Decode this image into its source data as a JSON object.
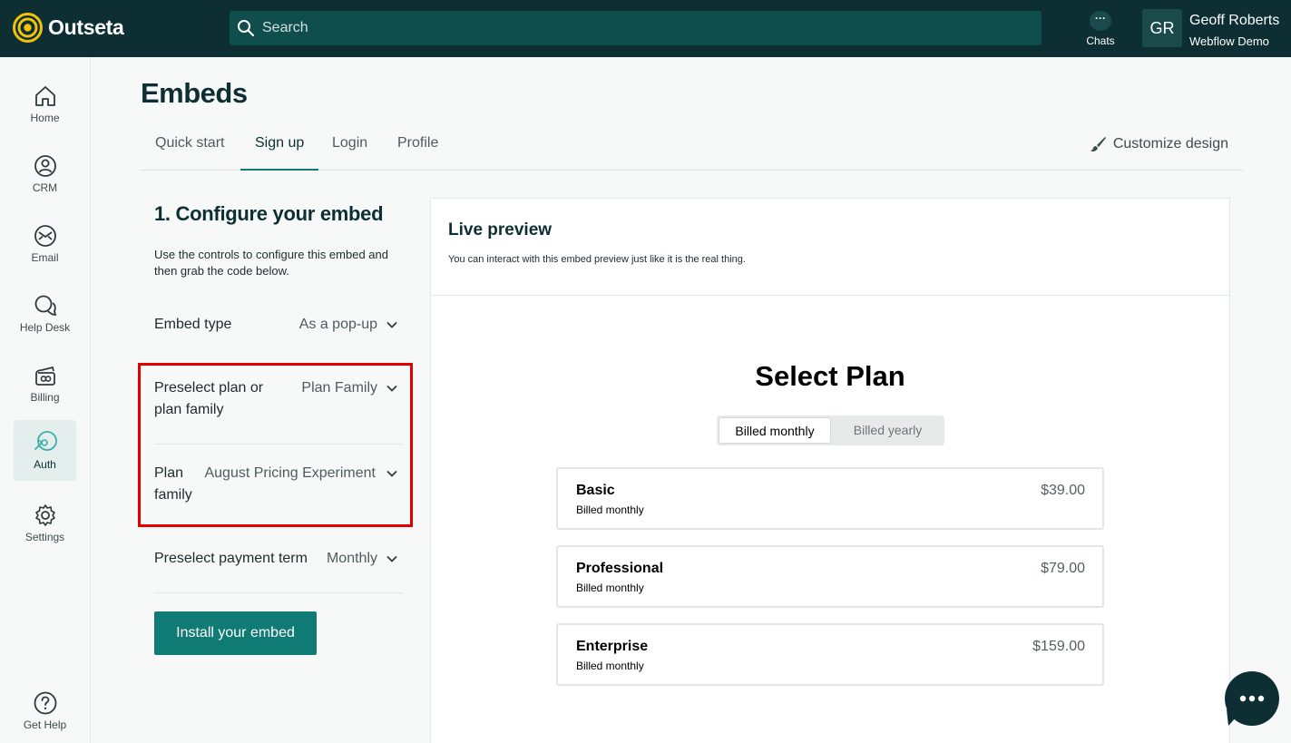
{
  "brand": {
    "name": "Outseta",
    "accent": "#f4c20d",
    "topbar_bg": "#0d2f33",
    "primary": "#0f7b74"
  },
  "search": {
    "placeholder": "Search"
  },
  "header": {
    "chats_label": "Chats",
    "chats_glyph": "···",
    "avatar_initials": "GR",
    "user_name": "Geoff Roberts",
    "user_org": "Webflow Demo"
  },
  "sidebar": {
    "items": [
      {
        "label": "Home",
        "icon": "home-icon"
      },
      {
        "label": "CRM",
        "icon": "crm-icon"
      },
      {
        "label": "Email",
        "icon": "email-icon"
      },
      {
        "label": "Help Desk",
        "icon": "help-desk-icon"
      },
      {
        "label": "Billing",
        "icon": "billing-icon"
      },
      {
        "label": "Auth",
        "icon": "auth-icon",
        "active": true
      },
      {
        "label": "Settings",
        "icon": "gear-icon"
      }
    ],
    "help_label": "Get Help"
  },
  "page": {
    "title": "Embeds",
    "tabs": [
      "Quick start",
      "Sign up",
      "Login",
      "Profile"
    ],
    "active_tab": "Sign up",
    "customize_label": "Customize design"
  },
  "config": {
    "title": "1. Configure your embed",
    "description": "Use the controls to configure this embed and then grab the code below.",
    "embed_type": {
      "label": "Embed type",
      "value": "As a pop-up"
    },
    "preselect": {
      "label_line1": "Preselect plan or",
      "label_line2": "plan family",
      "value": "Plan Family"
    },
    "plan_family": {
      "label_line1": "Plan",
      "label_line2": "family",
      "value": "August Pricing Experiment"
    },
    "payment_term": {
      "label": "Preselect payment term",
      "value": "Monthly"
    },
    "install_label": "Install your embed"
  },
  "preview": {
    "title": "Live preview",
    "subtitle": "You can interact with this embed preview just like it is the real thing.",
    "heading": "Select Plan",
    "toggle": {
      "monthly": "Billed monthly",
      "yearly": "Billed yearly",
      "selected": "monthly"
    },
    "plans": [
      {
        "name": "Basic",
        "term": "Billed monthly",
        "price": "$39.00"
      },
      {
        "name": "Professional",
        "term": "Billed monthly",
        "price": "$79.00"
      },
      {
        "name": "Enterprise",
        "term": "Billed monthly",
        "price": "$159.00"
      }
    ]
  }
}
